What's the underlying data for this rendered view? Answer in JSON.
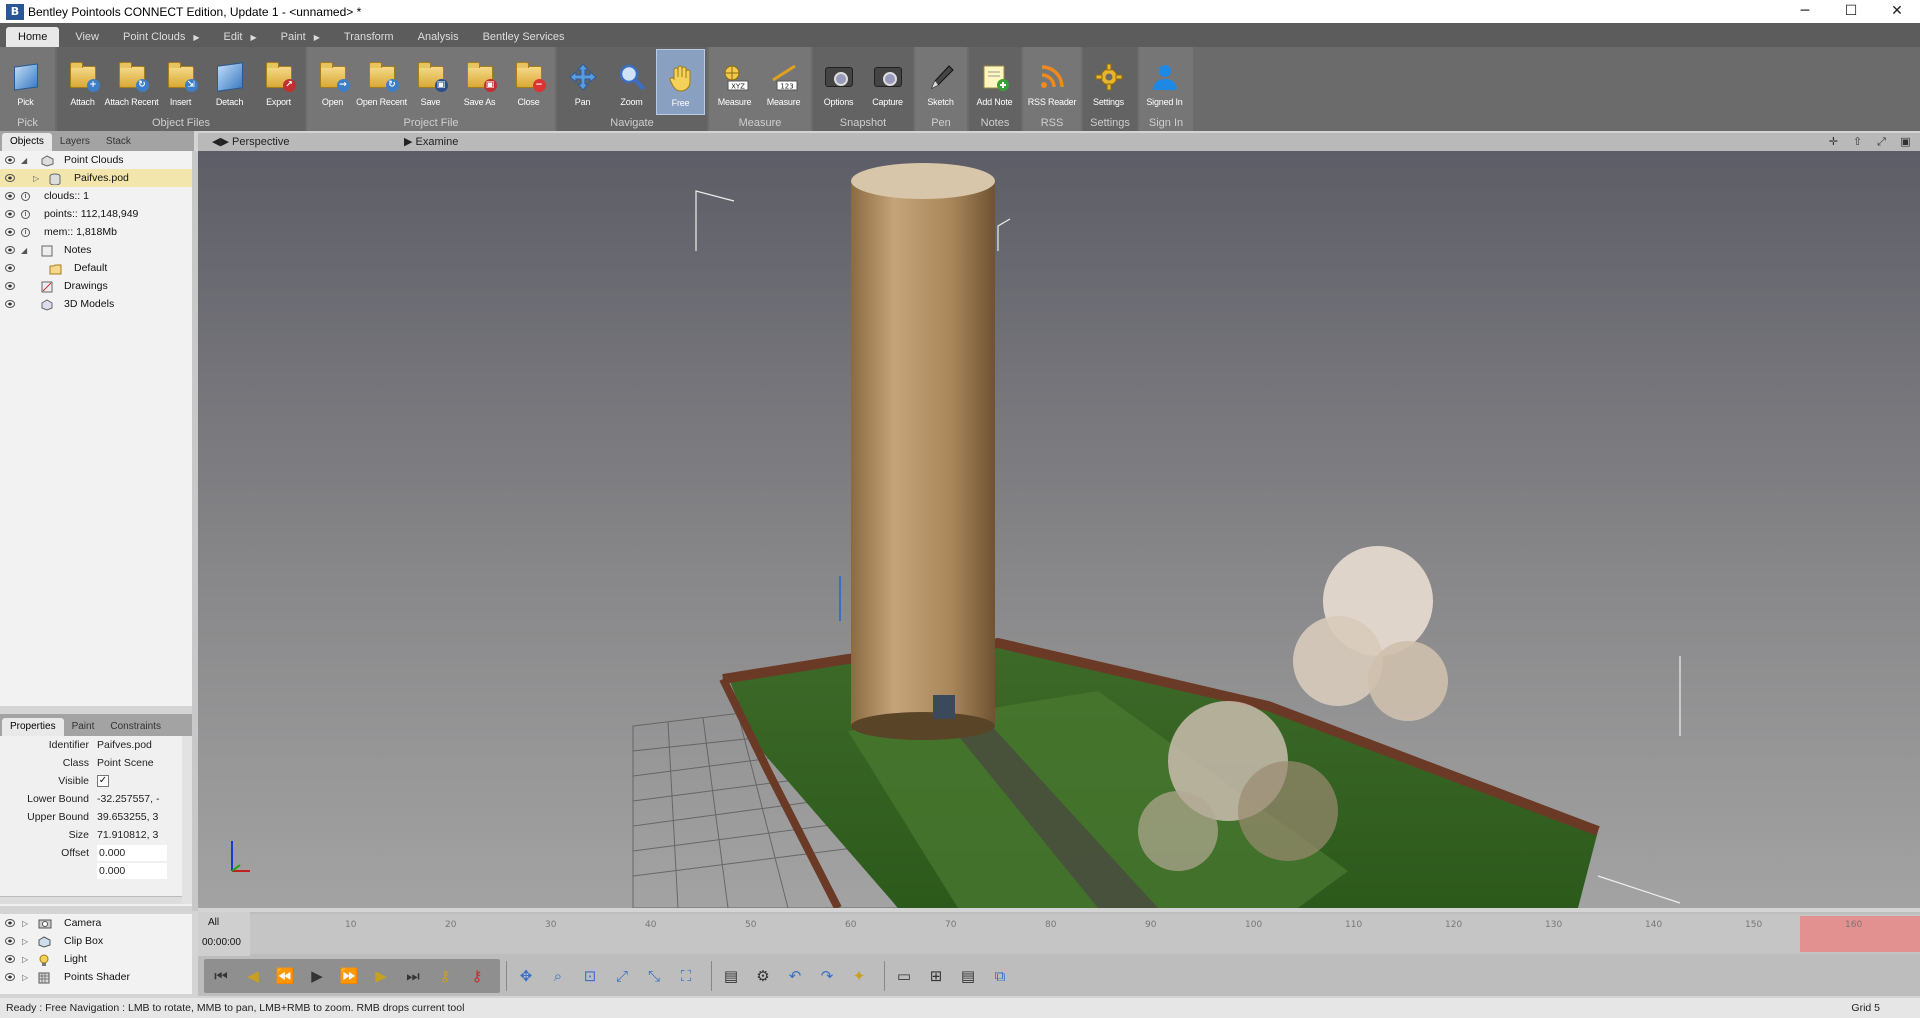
{
  "window": {
    "title": "Bentley Pointools CONNECT Edition, Update 1  -  <unnamed> *",
    "controls": [
      "─",
      "☐",
      "✕"
    ]
  },
  "menu_tabs": [
    {
      "label": "Home",
      "arrow": ""
    },
    {
      "label": "View",
      "arrow": ""
    },
    {
      "label": "Point Clouds",
      "arrow": "▶"
    },
    {
      "label": "Edit",
      "arrow": "▶"
    },
    {
      "label": "Paint",
      "arrow": "▶"
    },
    {
      "label": "Transform",
      "arrow": ""
    },
    {
      "label": "Analysis",
      "arrow": ""
    },
    {
      "label": "Bentley Services",
      "arrow": ""
    }
  ],
  "ribbon": {
    "pick": {
      "label": "Pick",
      "group": "Pick"
    },
    "object_files": {
      "group": "Object Files",
      "buttons": [
        "Attach",
        "Attach Recent",
        "Insert",
        "Detach",
        "Export"
      ]
    },
    "project_file": {
      "group": "Project File",
      "buttons": [
        "Open",
        "Open Recent",
        "Save",
        "Save As",
        "Close"
      ]
    },
    "navigate": {
      "group": "Navigate",
      "buttons": [
        "Pan",
        "Zoom",
        "Free"
      ]
    },
    "measure": {
      "group": "Measure",
      "buttons": [
        "Measure",
        "Measure"
      ],
      "badges": [
        "XYZ",
        "123"
      ]
    },
    "snapshot": {
      "group": "Snapshot",
      "buttons": [
        "Options",
        "Capture"
      ]
    },
    "pen": {
      "group": "Pen",
      "buttons": [
        "Sketch"
      ]
    },
    "notes": {
      "group": "Notes",
      "buttons": [
        "Add Note"
      ]
    },
    "rss": {
      "group": "RSS",
      "buttons": [
        "RSS Reader"
      ]
    },
    "settings": {
      "group": "Settings",
      "buttons": [
        "Settings"
      ]
    },
    "signin": {
      "group": "Sign In",
      "buttons": [
        "Signed In"
      ]
    }
  },
  "left_tabs": [
    "Objects",
    "Layers",
    "Stack"
  ],
  "view_bar": {
    "perspective": "Perspective",
    "examine": "Examine"
  },
  "tree": [
    {
      "label": "Point Clouds",
      "tri": "◢"
    },
    {
      "label": "Paifves.pod",
      "tri": "▷"
    },
    {
      "label": "clouds:: 1"
    },
    {
      "label": "points:: 112,148,949"
    },
    {
      "label": "mem:: 1,818Mb"
    },
    {
      "label": "Notes",
      "tri": "◢"
    },
    {
      "label": "Default"
    },
    {
      "label": "Drawings"
    },
    {
      "label": "3D Models"
    }
  ],
  "prop_tabs": [
    "Properties",
    "Paint",
    "Constraints"
  ],
  "properties": [
    {
      "key": "Identifier",
      "value": "Paifves.pod"
    },
    {
      "key": "Class",
      "value": "Point Scene"
    },
    {
      "key": "Visible",
      "value": "✓"
    },
    {
      "key": "Lower Bound",
      "value": "-32.257557, -"
    },
    {
      "key": "Upper Bound",
      "value": "39.653255, 3"
    },
    {
      "key": "Size",
      "value": "71.910812, 3"
    },
    {
      "key": "Offset",
      "value": "0.000"
    },
    {
      "key": "",
      "value": "0.000"
    }
  ],
  "scene_items": [
    "Camera",
    "Clip Box",
    "Light",
    "Points Shader"
  ],
  "timeline": {
    "all": "All",
    "time": "00:00:00",
    "ticks": [
      "10",
      "20",
      "30",
      "40",
      "50",
      "60",
      "70",
      "80",
      "90",
      "100",
      "110",
      "120",
      "130",
      "140",
      "150",
      "160"
    ]
  },
  "status": {
    "text": "Ready : Free Navigation : LMB to rotate, MMB to pan, LMB+RMB to zoom. RMB drops current tool",
    "grid": "Grid 5"
  },
  "colors": {
    "ribbon": "#6b6b6b",
    "menu_bar": "#5c5c5c",
    "tree_highlight": "#f3e6ad",
    "timeline_end": "#e29090"
  }
}
